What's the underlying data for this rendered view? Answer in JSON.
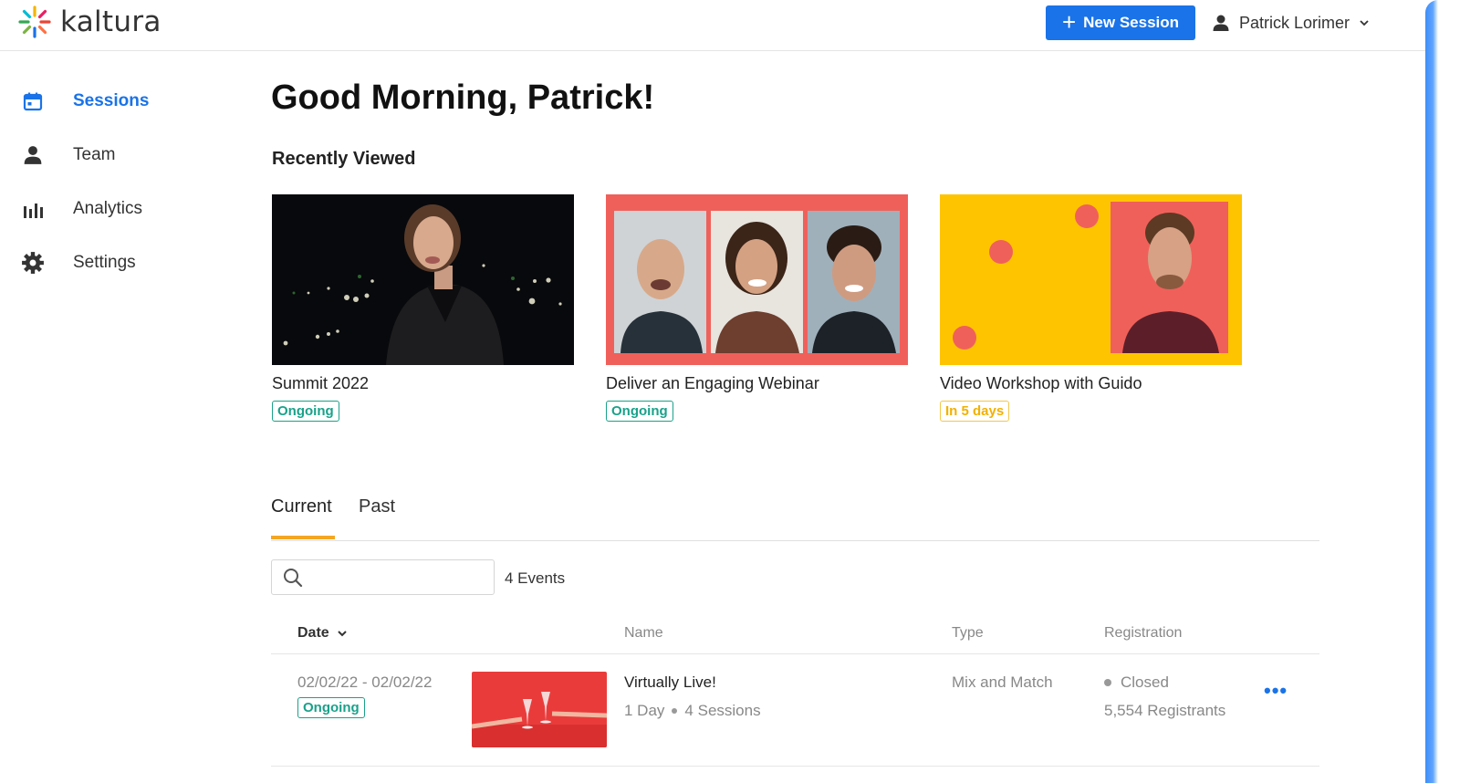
{
  "app": {
    "brand": "kaltura",
    "new_session_label": "New Session",
    "user_name": "Patrick Lorimer"
  },
  "sidebar": {
    "items": [
      {
        "label": "Sessions",
        "icon": "calendar-icon",
        "active": true
      },
      {
        "label": "Team",
        "icon": "person-icon",
        "active": false
      },
      {
        "label": "Analytics",
        "icon": "bar-chart-icon",
        "active": false
      },
      {
        "label": "Settings",
        "icon": "gear-icon",
        "active": false
      }
    ]
  },
  "main": {
    "greeting": "Good Morning, Patrick!",
    "recently_viewed_title": "Recently Viewed",
    "recent": [
      {
        "title": "Summit 2022",
        "status": "Ongoing"
      },
      {
        "title": "Deliver an Engaging Webinar",
        "status": "Ongoing"
      },
      {
        "title": "Video Workshop with Guido",
        "status": "In 5 days"
      }
    ],
    "tabs": [
      {
        "label": "Current",
        "active": true
      },
      {
        "label": "Past",
        "active": false
      }
    ],
    "search": {
      "placeholder": "",
      "value": ""
    },
    "event_count": "4 Events",
    "table": {
      "headers": {
        "date": "Date",
        "name": "Name",
        "type": "Type",
        "registration": "Registration"
      },
      "rows": [
        {
          "date": "02/02/22 - 02/02/22",
          "status": "Ongoing",
          "name": "Virtually Live!",
          "duration": "1 Day",
          "sessions": "4 Sessions",
          "type": "Mix and Match",
          "registration_status": "Closed",
          "registrants": "5,554 Registrants",
          "more_label": "•••"
        }
      ]
    }
  },
  "colors": {
    "accent": "#1a73e8",
    "ongoing": "#1aa18a",
    "upcoming": "#f2b100",
    "tab_underline": "#f5a623",
    "webinar_frame": "#f0605a",
    "workshop_bg": "#ffc400"
  }
}
